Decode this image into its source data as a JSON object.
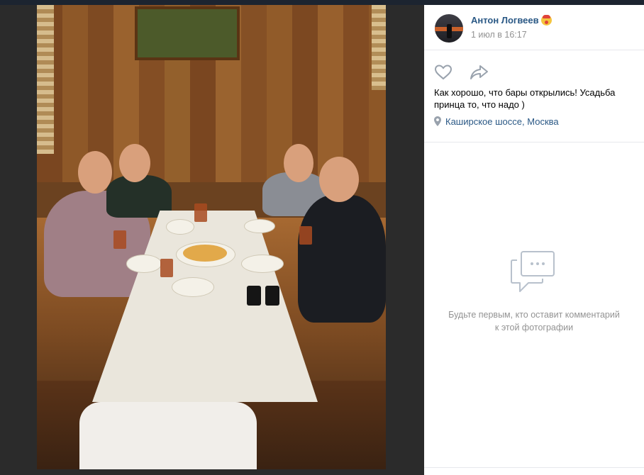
{
  "post": {
    "author": "Антон Логвеев",
    "author_emoji_icon": "clown-face-icon",
    "date": "1 июл в 16:17",
    "text": "Как хорошо, что бары открылись! Усадьба принца то, что надо )",
    "location": "Каширское шоссе, Москва",
    "icons": [
      "heart-icon",
      "share-arrow-icon",
      "map-pin-icon"
    ]
  },
  "comments": {
    "empty_icon": "comments-bubble-icon",
    "empty_text": "Будьте первым, кто оставит комментарий к этой фотографии"
  },
  "colors": {
    "link": "#2a5885",
    "muted": "#939393",
    "viewer_bg": "#2b2b2b"
  }
}
